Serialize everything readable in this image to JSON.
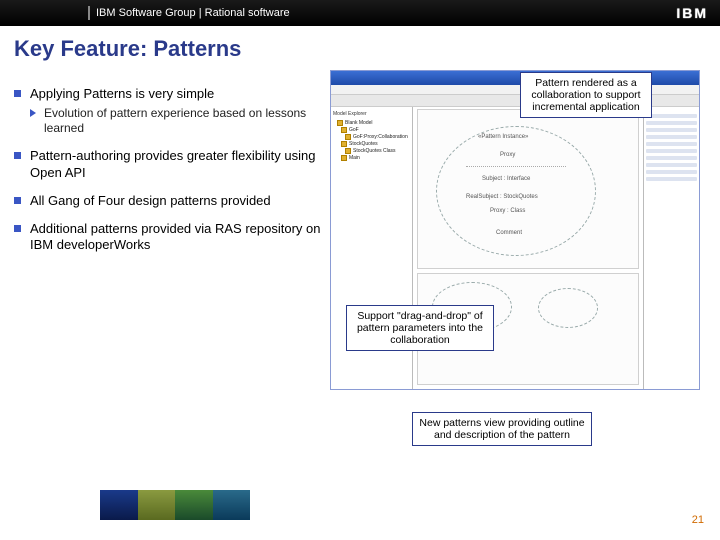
{
  "topbar": {
    "text": "IBM Software Group | Rational software",
    "logo": "IBM"
  },
  "title": "Key Feature: Patterns",
  "bullets": [
    {
      "text": "Applying Patterns is very simple",
      "sub": [
        "Evolution of pattern experience based on lessons learned"
      ]
    },
    {
      "text": "Pattern-authoring provides greater flexibility using Open API"
    },
    {
      "text": "All Gang of Four design patterns provided"
    },
    {
      "text": "Additional patterns provided via RAS repository on IBM developerWorks"
    }
  ],
  "callouts": {
    "c1": "Pattern rendered as a collaboration to support incremental application",
    "c2": "Support \"drag-and-drop\" of pattern parameters into the collaboration",
    "c3": "New patterns view providing outline and description of the pattern"
  },
  "screenshot": {
    "tree_title": "Model Explorer",
    "tree": [
      "Blank Model",
      "GoF",
      "GoF:Proxy:Collaboration",
      "StockQuotes",
      "StockQuotes Class",
      "Main"
    ],
    "diagram": {
      "pattern_tag": "«Pattern Instance»",
      "pattern_name": "Proxy",
      "role1": "Subject : Interface",
      "role2": "RealSubject : StockQuotes",
      "role3": "Proxy : Class",
      "comment": "Comment"
    }
  },
  "page": "21"
}
